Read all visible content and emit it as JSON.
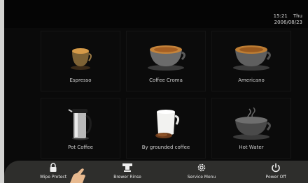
{
  "clock": {
    "time": "15:21",
    "day": "Thu",
    "date": "2006/08/23"
  },
  "drinks": [
    {
      "label": "Espresso",
      "icon": "espresso-cup-icon"
    },
    {
      "label": "Coffee Croma",
      "icon": "coffee-cup-icon"
    },
    {
      "label": "Americano",
      "icon": "americano-cup-icon"
    },
    {
      "label": "Pot Coffee",
      "icon": "coffee-pot-icon"
    },
    {
      "label": "By grounded coffee",
      "icon": "ground-coffee-cup-icon"
    },
    {
      "label": "Hot Water",
      "icon": "hot-water-cup-icon"
    }
  ],
  "toolbar": [
    {
      "label": "Wipe Protect",
      "icon": "lock-icon"
    },
    {
      "label": "Brewer Rinse",
      "icon": "brewer-icon"
    },
    {
      "label": "Service Menu",
      "icon": "gear-icon"
    },
    {
      "label": "Power Off",
      "icon": "power-icon"
    }
  ]
}
